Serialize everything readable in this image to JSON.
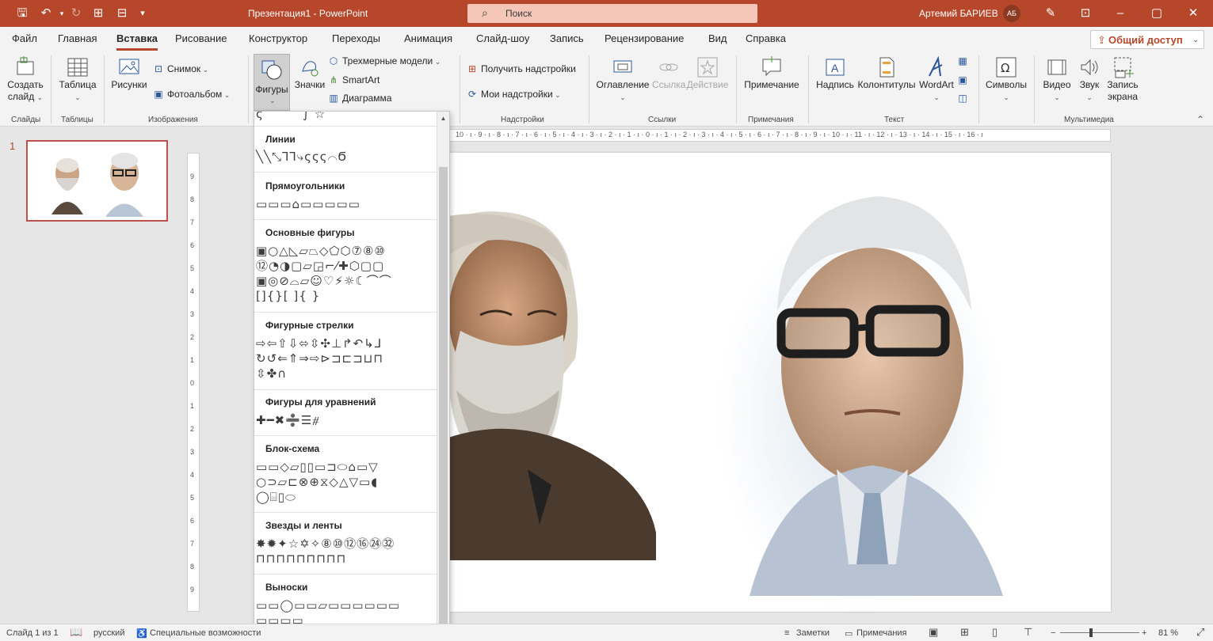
{
  "title_bar": {
    "doc_title": "Презентация1  -  PowerPoint",
    "search_icon": "search-icon",
    "search_placeholder": "Поиск",
    "user_name": "Артемий БАРИЕВ",
    "user_initials": "АБ"
  },
  "tabs": [
    "Файл",
    "Главная",
    "Вставка",
    "Рисование",
    "Конструктор",
    "Переходы",
    "Анимация",
    "Слайд-шоу",
    "Запись",
    "Рецензирование",
    "Вид",
    "Справка"
  ],
  "active_tab": "Вставка",
  "share_label": "Общий доступ",
  "ribbon": {
    "slides": {
      "new_slide_line1": "Создать",
      "new_slide_line2": "слайд",
      "group": "Слайды"
    },
    "tables": {
      "table": "Таблица",
      "group": "Таблицы"
    },
    "images": {
      "pictures": "Рисунки",
      "screenshot": "Снимок",
      "photo_album": "Фотоальбом",
      "group": "Изображения"
    },
    "illustrations": {
      "shapes": "Фигуры",
      "icons": "Значки",
      "models3d": "Трехмерные модели",
      "smartart": "SmartArt",
      "chart": "Диаграмма"
    },
    "addins": {
      "get": "Получить надстройки",
      "my": "Мои надстройки",
      "group": "Надстройки"
    },
    "links": {
      "zoom": "Оглавление",
      "link": "Ссылка",
      "action": "Действие",
      "group": "Ссылки"
    },
    "comments": {
      "comment": "Примечание",
      "group": "Примечания"
    },
    "text": {
      "textbox": "Надпись",
      "header_footer": "Колонтитулы",
      "wordart": "WordArt",
      "group": "Текст"
    },
    "symbols": {
      "symbols": "Символы"
    },
    "media": {
      "video": "Видео",
      "audio": "Звук",
      "screen_rec_line1": "Запись",
      "screen_rec_line2": "экрана",
      "group": "Мультимедиа"
    }
  },
  "shapes_menu": {
    "categories": [
      {
        "label": "Линии",
        "rows": [
          "╲╲⤡⅂⅂⤷ςςς⌒Ϭ"
        ]
      },
      {
        "label": "Прямоугольники",
        "rows": [
          "▭▭▭⌂▭▭▭▭▭"
        ]
      },
      {
        "label": "Основные фигуры",
        "rows": [
          "▣○△◺▱⏢◇⬠⬡⑦⑧⑩",
          "⑫◔◑▢▱◲⌐⁄✚⬡▢▢",
          "▣◎⊘⌓▱☺♡⚡☼☾⌒⌒",
          "[]{}[ ]{ }"
        ]
      },
      {
        "label": "Фигурные стрелки",
        "rows": [
          "⇨⇦⇧⇩⬄⇳✣⊥↱↶↳⅃",
          "↻↺⇐⇑⇒⇨⊳⊐⊏⊐⊔⊓",
          "⇳✤∩"
        ]
      },
      {
        "label": "Фигуры для уравнений",
        "rows": [
          "✚━✖➗☰⧣"
        ]
      },
      {
        "label": "Блок-схема",
        "rows": [
          "▭▭◇▱▯▯▭⊐⬭⌂▭▽",
          "○⊃▱⊏⊗⊕⧖◇△▽▭◖",
          "◯⌸▯⬭"
        ]
      },
      {
        "label": "Звезды и ленты",
        "rows": [
          "✸✹✦☆✡✧⑧⑩⑫⑯㉔㉜",
          "⊓⊓⊓⊓⊓⊓⊓⊓⊓"
        ]
      },
      {
        "label": "Выноски",
        "rows": [
          "▭▭◯▭▭▱▭▭▭▭▭▭",
          "▭▭▭▭"
        ]
      }
    ]
  },
  "slide_pane": {
    "slide_number": "1"
  },
  "horizontal_ruler": "10 · ı · 9 · ı · 8 · ı · 7 · ı · 6 · ı · 5 · ı · 4 · ı · 3 · ı · 2 · ı · 1 · ı · 0 · ı · 1 · ı · 2 · ı · 3 · ı · 4 · ı · 5 · ı · 6 · ı · 7 · ı · 8 · ı · 9 · ı · 10 · ı · 11 · ı · 12 · ı · 13 · ı · 14 · ı · 15 · ı · 16 · ı",
  "vertical_ruler_ticks": [
    "9",
    "8",
    "7",
    "6",
    "5",
    "4",
    "3",
    "2",
    "1",
    "0",
    "1",
    "2",
    "3",
    "4",
    "5",
    "6",
    "7",
    "8",
    "9"
  ],
  "status_bar": {
    "slide_info": "Слайд 1 из 1",
    "language": "русский",
    "accessibility": "Специальные возможности",
    "notes": "Заметки",
    "comments": "Примечания",
    "zoom_minus": "−",
    "zoom_plus": "+",
    "zoom_level": "81 %",
    "zoom_percent": 81
  }
}
